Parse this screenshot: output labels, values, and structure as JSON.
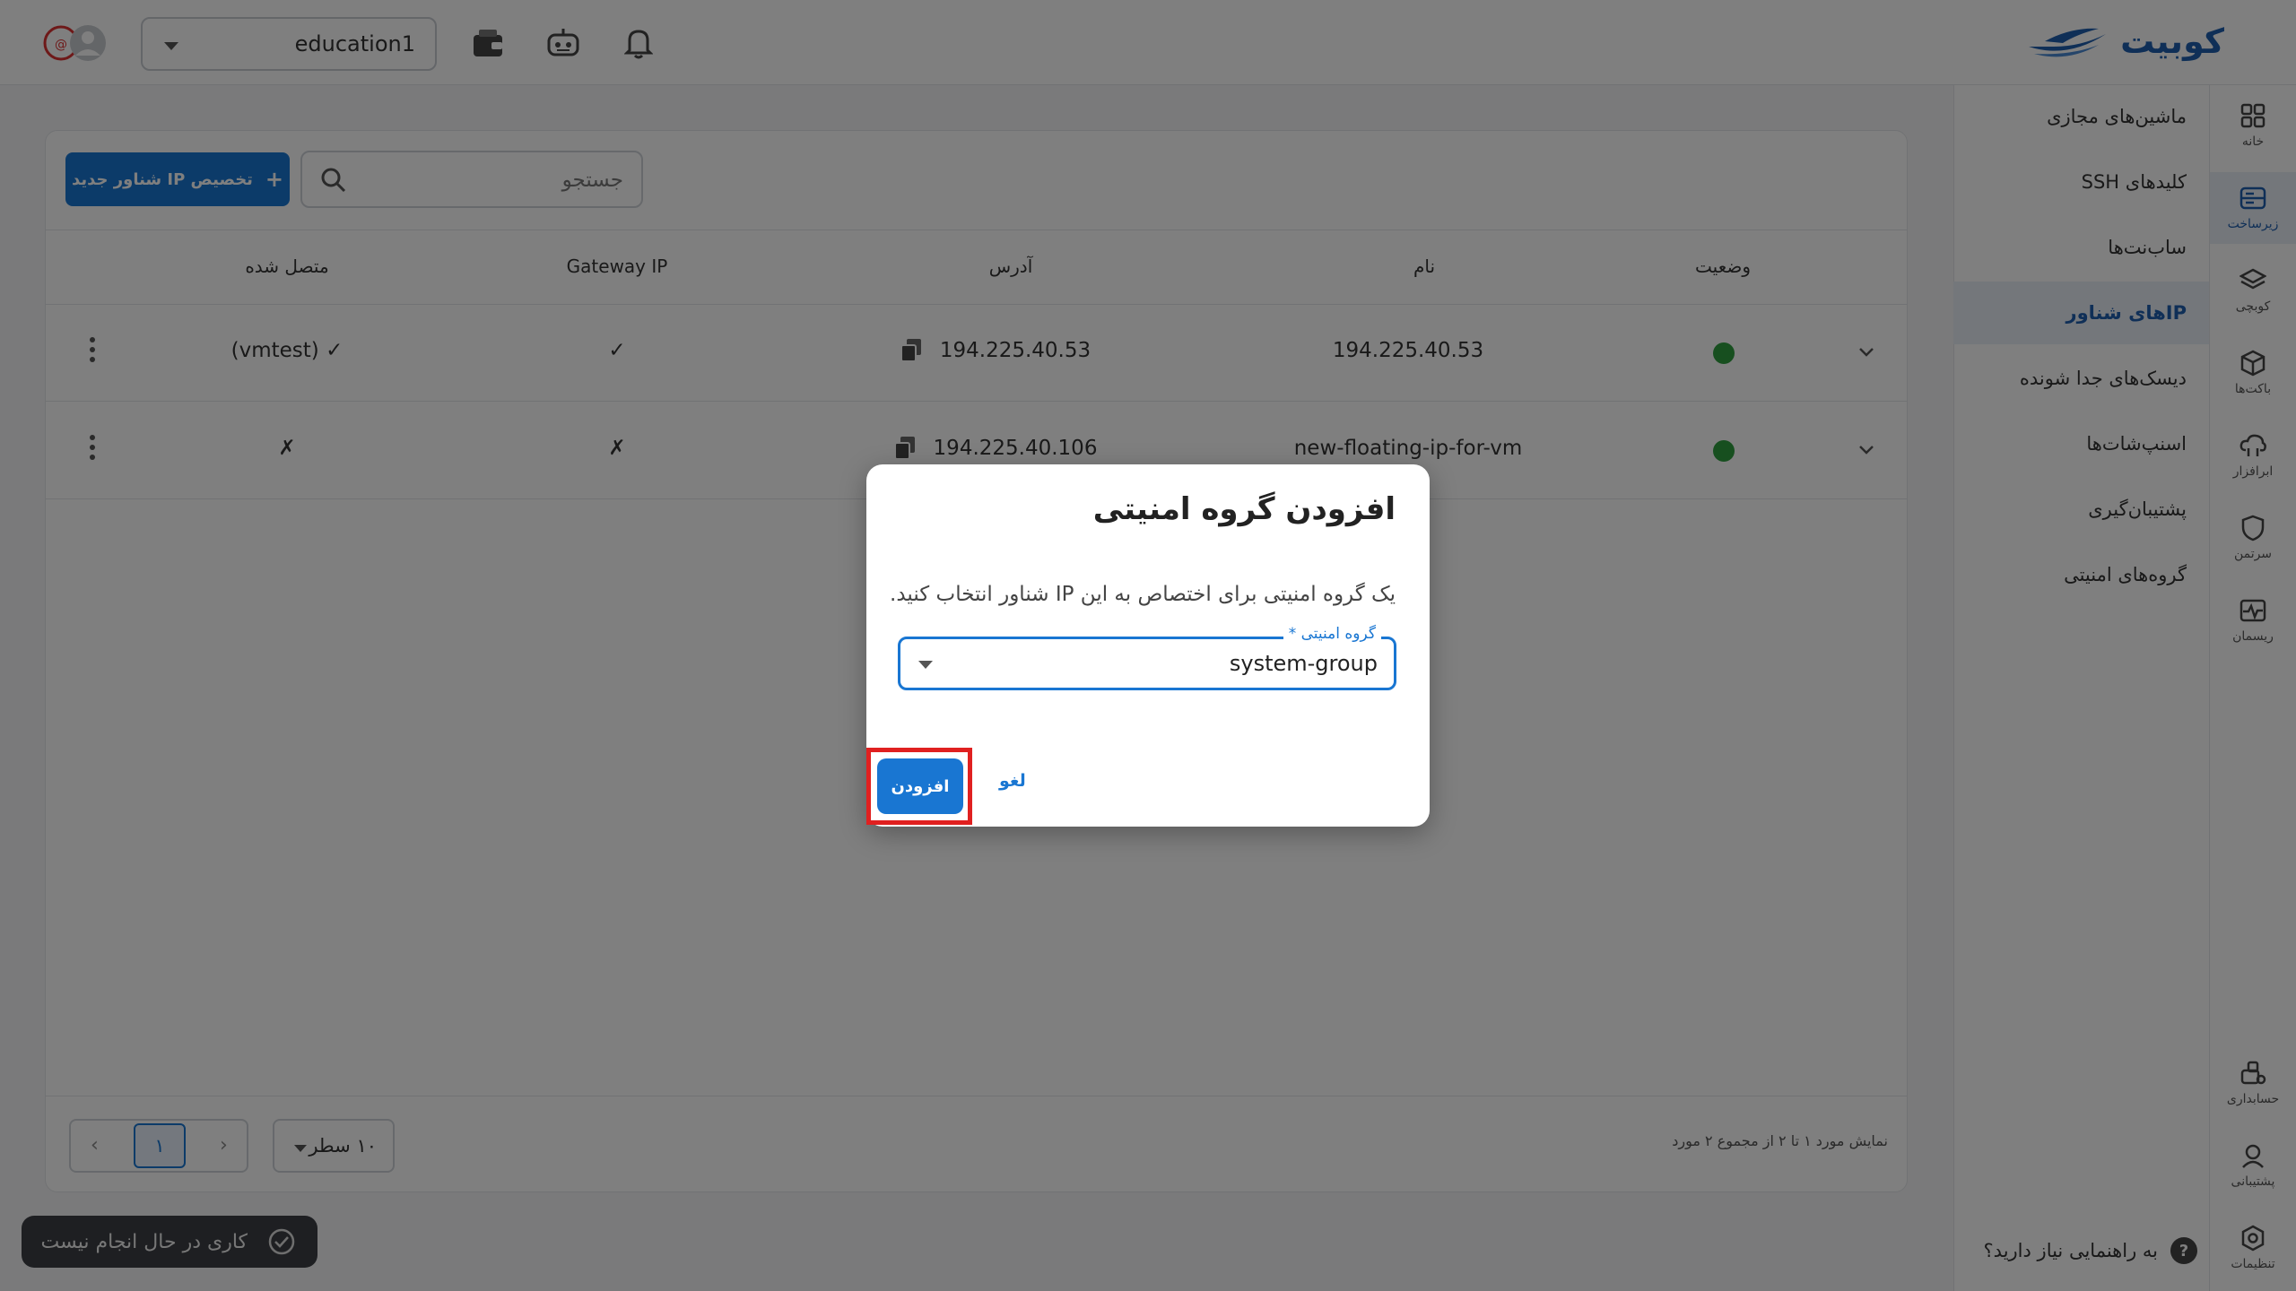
{
  "brand": {
    "name": "کوبیت",
    "color": "#1f5fae"
  },
  "topbar": {
    "workspace": "education1",
    "icons": [
      "wallet-icon",
      "robot-icon",
      "bell-icon"
    ]
  },
  "rail": {
    "items": [
      {
        "label": "خانه",
        "icon": "grid-icon"
      },
      {
        "label": "زیرساخت",
        "icon": "server-icon"
      },
      {
        "label": "کوبچی",
        "icon": "layers-icon"
      },
      {
        "label": "باکت‌ها",
        "icon": "cube-icon"
      },
      {
        "label": "ابرافزار",
        "icon": "cloud-app-icon"
      },
      {
        "label": "سرتمن",
        "icon": "shield-icon"
      },
      {
        "label": "ریسمان",
        "icon": "pulse-icon"
      },
      {
        "label": "حسابداری",
        "icon": "accounting-icon"
      },
      {
        "label": "پشتیبانی",
        "icon": "support-icon"
      },
      {
        "label": "تنظیمات",
        "icon": "settings-icon"
      }
    ]
  },
  "submenu": {
    "items": [
      {
        "label": "ماشین‌های مجازی"
      },
      {
        "label": "کلیدهای SSH"
      },
      {
        "label": "ساب‌نت‌ها"
      },
      {
        "label": "IPهای شناور"
      },
      {
        "label": "دیسک‌های جدا شونده"
      },
      {
        "label": "اسنپ‌شات‌ها"
      },
      {
        "label": "پشتیبان‌گیری"
      },
      {
        "label": "گروه‌های امنیتی"
      }
    ],
    "help": "به راهنمایی نیاز دارید؟",
    "help_icon": "?"
  },
  "main": {
    "new_button": "تخصیص IP شناور جدید",
    "new_button_icon": "+",
    "search_placeholder": "جستجو",
    "columns": {
      "status": "وضعیت",
      "name": "نام",
      "address": "آدرس",
      "gateway": "Gateway IP",
      "connected": "متصل شده"
    },
    "rows": [
      {
        "name": "194.225.40.53",
        "address": "194.225.40.53",
        "gateway": "✓",
        "connected": "(vmtest) ✓"
      },
      {
        "name": "new-floating-ip-for-vm",
        "address": "194.225.40.106",
        "gateway": "✗",
        "connected": "✗"
      }
    ],
    "status_color": "#2e9e3e",
    "pagination": {
      "info": "نمایش مورد ۱ تا ۲ از مجموع ۲ مورد",
      "rows_per_page": "۱۰ سطر",
      "current": "۱",
      "prev": "‹",
      "next": "›"
    }
  },
  "toast": {
    "text": "کاری در حال انجام نیست"
  },
  "dialog": {
    "title": "افزودن گروه امنیتی",
    "description": "یک گروه امنیتی برای اختصاص به این IP شناور انتخاب کنید.",
    "field_label": "گروه امنیتی *",
    "field_value": "system-group",
    "add": "افزودن",
    "cancel": "لغو",
    "accent": "#1976d2"
  }
}
